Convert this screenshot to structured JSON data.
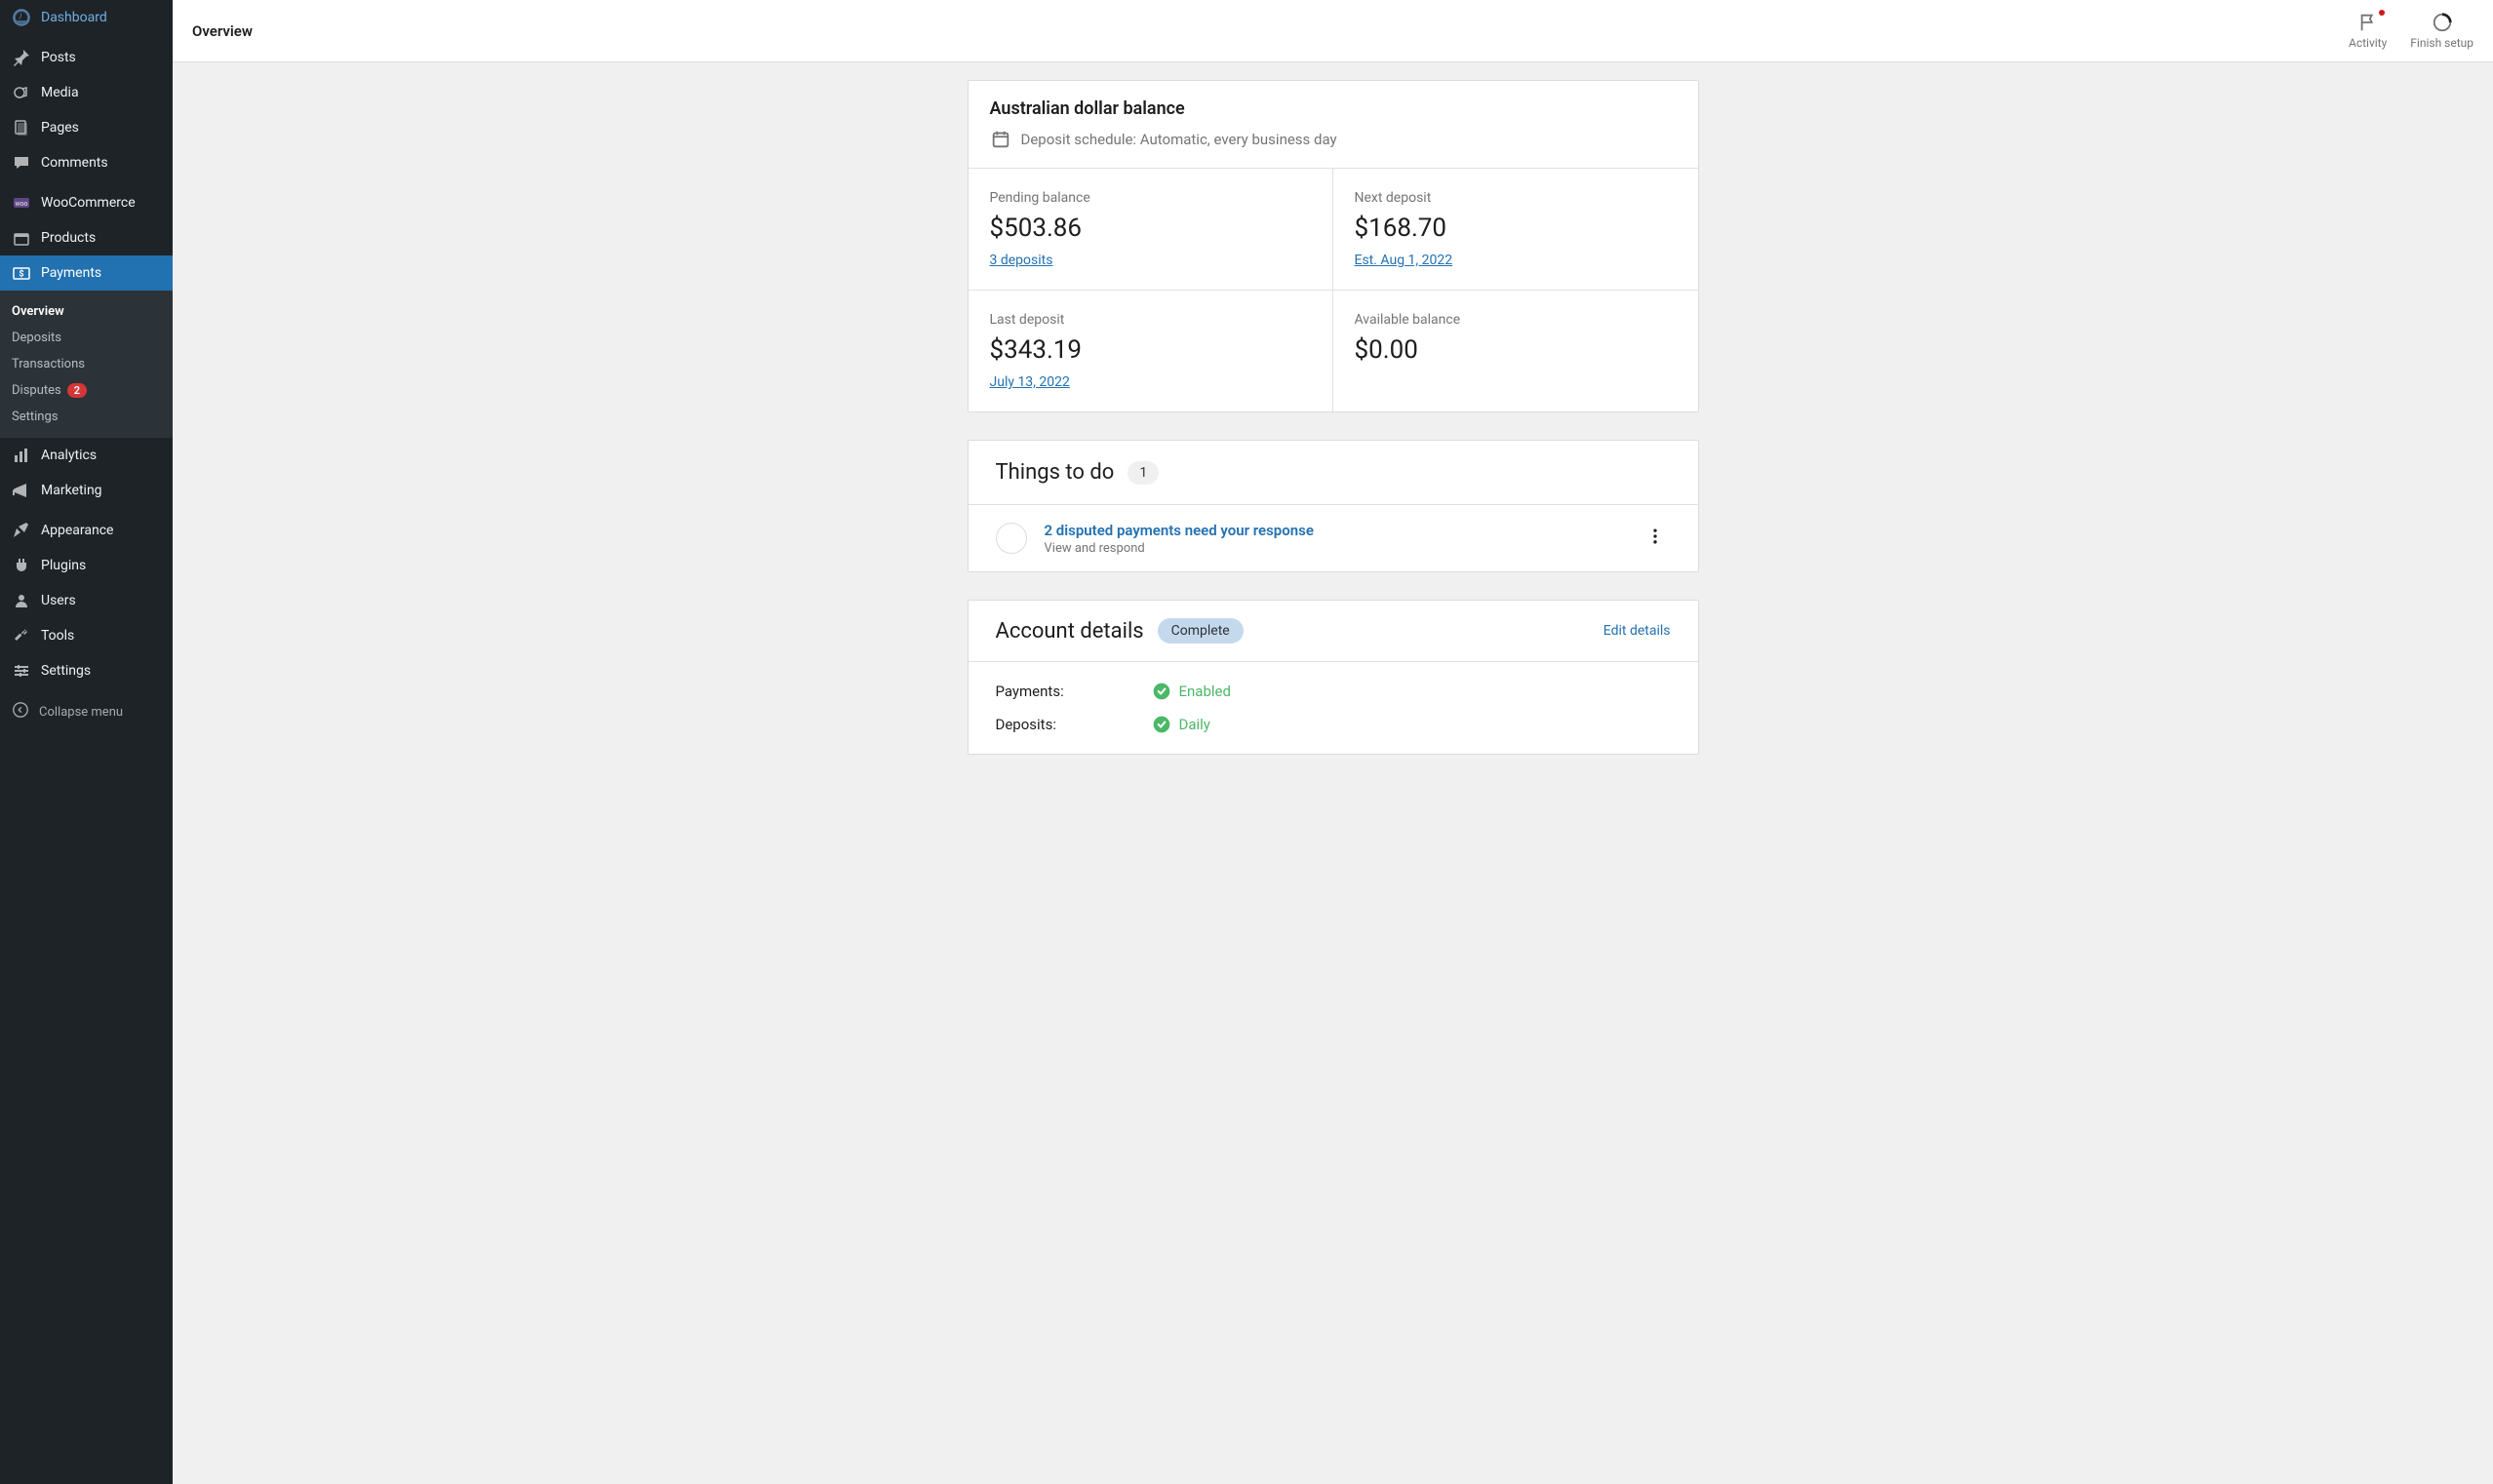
{
  "sidebar": {
    "items": [
      {
        "label": "Dashboard",
        "icon": "dashboard-icon"
      },
      {
        "label": "Posts",
        "icon": "pin-icon"
      },
      {
        "label": "Media",
        "icon": "media-icon"
      },
      {
        "label": "Pages",
        "icon": "pages-icon"
      },
      {
        "label": "Comments",
        "icon": "comments-icon"
      },
      {
        "label": "WooCommerce",
        "icon": "woo-icon"
      },
      {
        "label": "Products",
        "icon": "products-icon"
      },
      {
        "label": "Payments",
        "icon": "payments-icon",
        "active": true
      },
      {
        "label": "Analytics",
        "icon": "analytics-icon"
      },
      {
        "label": "Marketing",
        "icon": "marketing-icon"
      },
      {
        "label": "Appearance",
        "icon": "appearance-icon"
      },
      {
        "label": "Plugins",
        "icon": "plugins-icon"
      },
      {
        "label": "Users",
        "icon": "users-icon"
      },
      {
        "label": "Tools",
        "icon": "tools-icon"
      },
      {
        "label": "Settings",
        "icon": "settings-icon"
      }
    ],
    "submenu": [
      {
        "label": "Overview",
        "active": true
      },
      {
        "label": "Deposits"
      },
      {
        "label": "Transactions"
      },
      {
        "label": "Disputes",
        "badge": "2"
      },
      {
        "label": "Settings"
      }
    ],
    "collapse": "Collapse menu"
  },
  "topbar": {
    "title": "Overview",
    "activity": "Activity",
    "finish": "Finish setup"
  },
  "balance": {
    "title": "Australian dollar balance",
    "schedule": "Deposit schedule: Automatic, every business day",
    "cells": [
      {
        "label": "Pending balance",
        "value": "$503.86",
        "link": "3 deposits"
      },
      {
        "label": "Next deposit",
        "value": "$168.70",
        "link": "Est. Aug 1, 2022"
      },
      {
        "label": "Last deposit",
        "value": "$343.19",
        "link": "July 13, 2022"
      },
      {
        "label": "Available balance",
        "value": "$0.00",
        "link": ""
      }
    ]
  },
  "things": {
    "title": "Things to do",
    "count": "1",
    "todo_title": "2 disputed payments need your response",
    "todo_sub": "View and respond"
  },
  "account": {
    "title": "Account details",
    "status": "Complete",
    "edit": "Edit details",
    "rows": [
      {
        "label": "Payments:",
        "status": "Enabled"
      },
      {
        "label": "Deposits:",
        "status": "Daily"
      }
    ]
  }
}
